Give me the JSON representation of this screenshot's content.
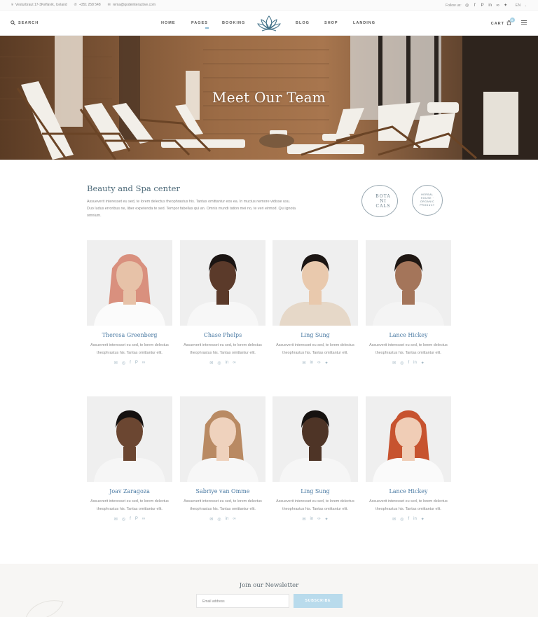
{
  "topbar": {
    "address": "Vesturbraut 17-3Keflavík, Iceland",
    "phone": "+351 258 548",
    "email": "rema@qodeinteractive.com",
    "follow_label": "Follow us:",
    "language": "EN"
  },
  "header": {
    "search_label": "SEARCH",
    "nav": [
      "HOME",
      "PAGES",
      "BOOKING",
      "BLOG",
      "SHOP",
      "LANDING"
    ],
    "cart_label": "CART",
    "cart_count": "0"
  },
  "hero": {
    "title": "Meet Our Team"
  },
  "intro": {
    "title": "Beauty and Spa center",
    "text": "Assueverit interesset eu sed, te lorem delectus theophrastus his. Tantas omittantur eos ea. In mucius nemore vidisse usu. Duo ludus erroribus ne, liber expetenda te sed. Tempor fabellas qui an. Omnis mundi tation mei no, te veri eirmod. Qui ignota omnium.",
    "badge1": "BOTA NI CALS",
    "badge2": "HERBAL HOUSE · ORGANIC PRODUCT"
  },
  "team": [
    {
      "name": "Theresa Greenberg",
      "desc": "Assueverit interesset eu sed, te lorem delectus theophrastus his. Tantas omittantur elit.",
      "socials": [
        "mail-icon",
        "instagram-icon",
        "facebook-icon",
        "pinterest-icon",
        "tripadvisor-icon"
      ]
    },
    {
      "name": "Chase Phelps",
      "desc": "Assueverit interesset eu sed, te lorem delectus theophrastus his. Tantas omittantur elit.",
      "socials": [
        "mail-icon",
        "instagram-icon",
        "linkedin-icon",
        "tripadvisor-icon"
      ]
    },
    {
      "name": "Ling Sung",
      "desc": "Assueverit interesset eu sed, te lorem delectus theophrastus his. Tantas omittantur elit.",
      "socials": [
        "mail-icon",
        "linkedin-icon",
        "tripadvisor-icon",
        "twitter-icon"
      ]
    },
    {
      "name": "Lance Hickey",
      "desc": "Assueverit interesset eu sed, te lorem delectus theophrastus his. Tantas omittantur elit.",
      "socials": [
        "mail-icon",
        "instagram-icon",
        "facebook-icon",
        "linkedin-icon",
        "twitter-icon"
      ]
    },
    {
      "name": "Joav Zaragoza",
      "desc": "Assueverit interesset eu sed, te lorem delectus theophrastus his. Tantas omittantur elit.",
      "socials": [
        "mail-icon",
        "instagram-icon",
        "facebook-icon",
        "pinterest-icon",
        "tripadvisor-icon"
      ]
    },
    {
      "name": "Sabriye van Omme",
      "desc": "Assueverit interesset eu sed, te lorem delectus theophrastus his. Tantas omittantur elit.",
      "socials": [
        "mail-icon",
        "instagram-icon",
        "linkedin-icon",
        "tripadvisor-icon"
      ]
    },
    {
      "name": "Ling Sung",
      "desc": "Assueverit interesset eu sed, te lorem delectus theophrastus his. Tantas omittantur elit.",
      "socials": [
        "mail-icon",
        "linkedin-icon",
        "tripadvisor-icon",
        "twitter-icon"
      ]
    },
    {
      "name": "Lance Hickey",
      "desc": "Assueverit interesset eu sed, te lorem delectus theophrastus his. Tantas omittantur elit.",
      "socials": [
        "mail-icon",
        "instagram-icon",
        "facebook-icon",
        "linkedin-icon",
        "twitter-icon"
      ]
    }
  ],
  "newsletter": {
    "title": "Join our Newsletter",
    "placeholder": "Email address",
    "button": "SUBSCRIBE"
  },
  "colors": {
    "accent": "#b9dbec",
    "name_blue": "#4a7aa3",
    "heading": "#4c6978"
  }
}
